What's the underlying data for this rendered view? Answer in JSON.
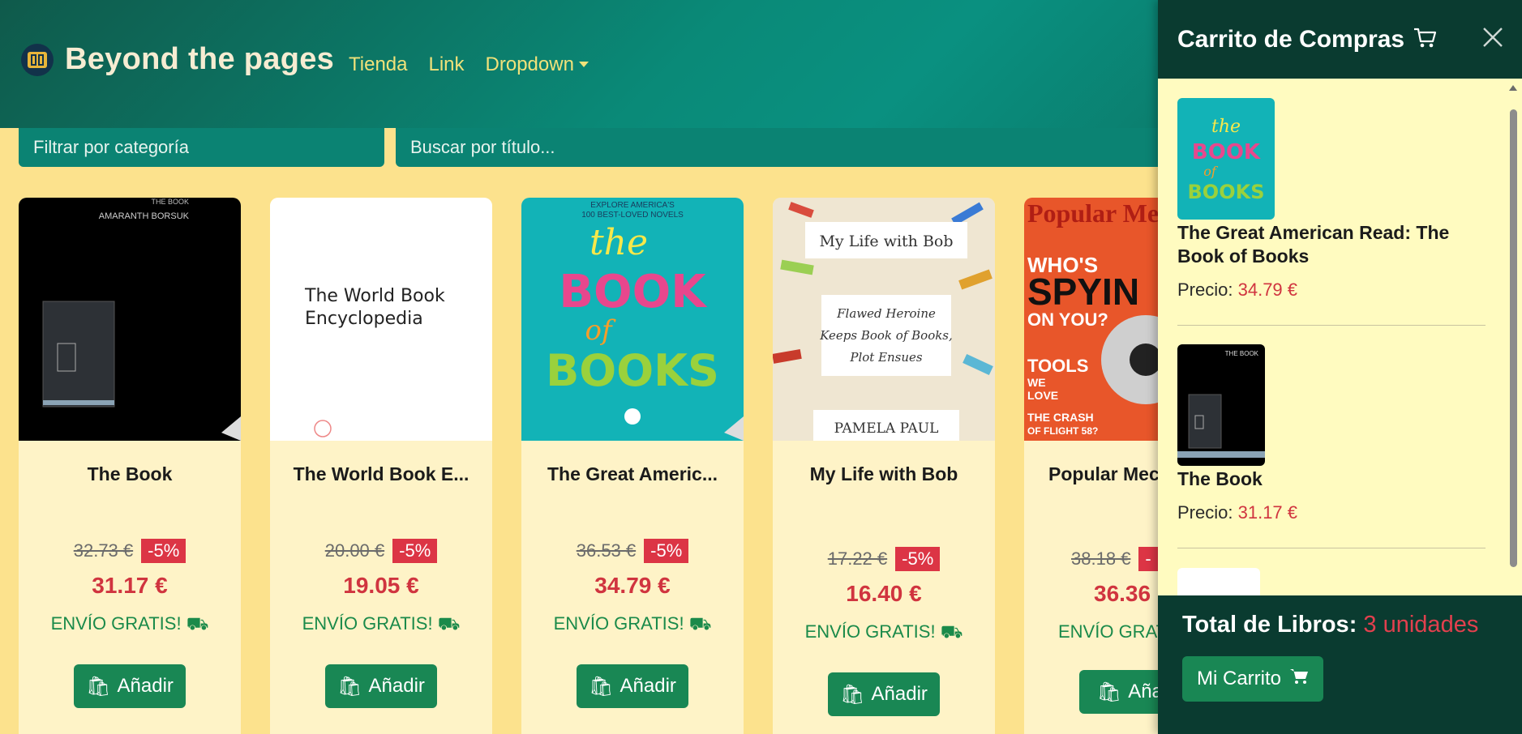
{
  "navbar": {
    "brand": "Beyond the pages",
    "links": [
      "Tienda",
      "Link",
      "Dropdown"
    ]
  },
  "filters": {
    "category_placeholder": "Filtrar por categoría",
    "search_placeholder": "Buscar por título..."
  },
  "products": [
    {
      "title": "The Book",
      "old_price": "32.73 €",
      "discount": "-5%",
      "price": "31.17 €",
      "shipping": "ENVÍO GRATIS!",
      "button": "Añadir",
      "cover": "the-book-cover"
    },
    {
      "title": "The World Book E...",
      "old_price": "20.00 €",
      "discount": "-5%",
      "price": "19.05 €",
      "shipping": "ENVÍO GRATIS!",
      "button": "Añadir",
      "cover": "world-book-cover"
    },
    {
      "title": "The Great Americ...",
      "old_price": "36.53 €",
      "discount": "-5%",
      "price": "34.79 €",
      "shipping": "ENVÍO GRATIS!",
      "button": "Añadir",
      "cover": "book-of-books-cover"
    },
    {
      "title": "My Life with Bob",
      "old_price": "17.22 €",
      "discount": "-5%",
      "price": "16.40 €",
      "shipping": "ENVÍO GRATIS!",
      "button": "Añadir",
      "cover": "life-with-bob-cover"
    },
    {
      "title": "Popular Mec",
      "old_price": "38.18 €",
      "discount": "-",
      "price": "36.36",
      "shipping": "ENVÍO GRAT",
      "button": "Añad",
      "cover": "popular-mechanics-cover"
    }
  ],
  "covers": {
    "the_book": {
      "author": "AMARANTH BORSUK",
      "title": "THE BOOK"
    },
    "world_book": {
      "line1": "The World Book",
      "line2": "Encyclopedia"
    },
    "book_of_books": {
      "top1": "EXPLORE AMERICA'S",
      "top2": "100 BEST-LOVED NOVELS",
      "the": "the",
      "b1": "BOOK",
      "of": "of",
      "b2": "BOOKS"
    },
    "life_with_bob": {
      "title": "My Life with Bob",
      "sub1": "Flawed Heroine",
      "sub2": "Keeps Book of Books,",
      "sub3": "Plot Ensues",
      "author": "PAMELA PAUL"
    },
    "popular_mechanics": {
      "brand": "Popular Mecha",
      "l1": "WHO'S",
      "l2": "SPYIN",
      "l3": "ON YOU?",
      "l4": "TOOLS",
      "l5": "WE",
      "l6": "LOVE",
      "l7": "THE CRASH",
      "l8": "OF FLIGHT 58?"
    }
  },
  "cart": {
    "title": "Carrito de Compras",
    "items": [
      {
        "title": "The Great American Read: The Book of Books",
        "price_label": "Precio:",
        "price": "34.79 €"
      },
      {
        "title": "The Book",
        "price_label": "Precio:",
        "price": "31.17 €"
      }
    ],
    "total_label": "Total de Libros:",
    "total_units": "3 unidades",
    "button": "Mi Carrito"
  },
  "colors": {
    "navbar": "#0a8a78",
    "background": "#fce28d",
    "card": "#fef3c7",
    "accent_red": "#dc3545",
    "button_green": "#198754",
    "cart_dark": "#0a3b30",
    "cart_bg": "#fffbc0"
  }
}
